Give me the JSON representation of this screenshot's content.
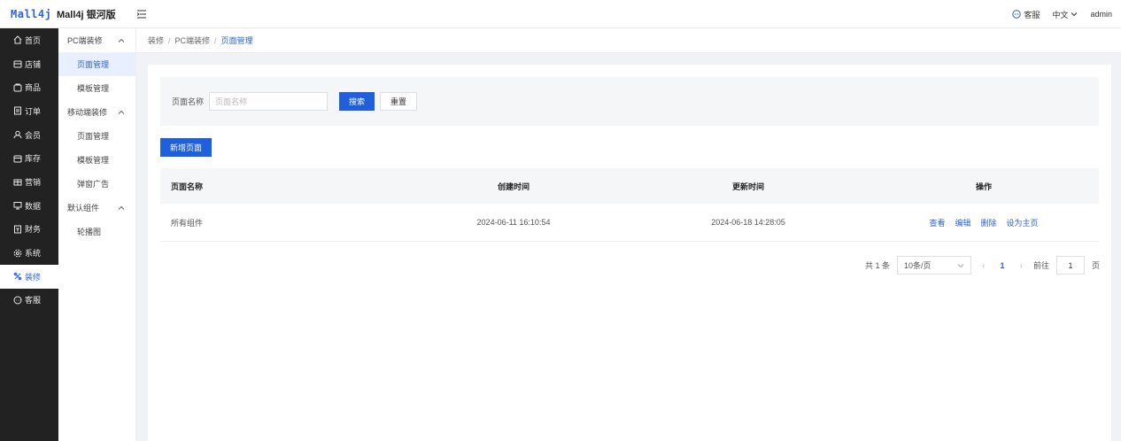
{
  "header": {
    "logo": "Mall4j",
    "brand": "Mall4j 银河版",
    "service_label": "客服",
    "lang_label": "中文",
    "user_label": "admin"
  },
  "sidebar": {
    "items": [
      {
        "label": "首页",
        "icon": "home-icon"
      },
      {
        "label": "店铺",
        "icon": "shop-icon"
      },
      {
        "label": "商品",
        "icon": "goods-icon"
      },
      {
        "label": "订单",
        "icon": "order-icon"
      },
      {
        "label": "会员",
        "icon": "member-icon"
      },
      {
        "label": "库存",
        "icon": "stock-icon"
      },
      {
        "label": "营销",
        "icon": "gift-icon"
      },
      {
        "label": "数据",
        "icon": "data-icon"
      },
      {
        "label": "财务",
        "icon": "finance-icon"
      },
      {
        "label": "系统",
        "icon": "gear-icon"
      },
      {
        "label": "装修",
        "icon": "decor-icon",
        "active": true
      },
      {
        "label": "客服",
        "icon": "chat-icon"
      }
    ]
  },
  "subnav": {
    "groups": [
      {
        "label": "PC端装修",
        "items": [
          "页面管理",
          "模板管理"
        ]
      },
      {
        "label": "移动端装修",
        "items": [
          "页面管理",
          "模板管理",
          "弹窗广告"
        ]
      },
      {
        "label": "默认组件",
        "items": [
          "轮播图"
        ]
      }
    ]
  },
  "breadcrumb": {
    "a": "装修",
    "b": "PC端装修",
    "c": "页面管理",
    "sep": "/"
  },
  "search": {
    "label": "页面名称",
    "placeholder": "页面名称",
    "search_btn": "搜索",
    "reset_btn": "重置"
  },
  "add_btn": "新增页面",
  "table": {
    "headers": [
      "页面名称",
      "创建时间",
      "更新时间",
      "操作"
    ],
    "rows": [
      {
        "name": "所有组件",
        "created": "2024-06-11 16:10:54",
        "updated": "2024-06-18 14:28:05"
      }
    ],
    "actions": [
      "查看",
      "编辑",
      "删除",
      "设为主页"
    ]
  },
  "pager": {
    "total": "共 1 条",
    "size": "10条/页",
    "page": "1",
    "goto_label": "前往",
    "goto_value": "1",
    "page_unit": "页"
  },
  "colors": {
    "primary": "#1f5fdb",
    "sidebar_bg": "#222222",
    "active_bg": "#e8efff"
  }
}
